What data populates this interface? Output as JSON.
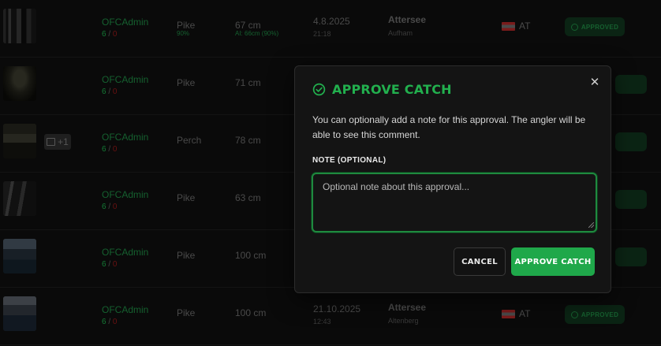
{
  "rows": [
    {
      "user": "OFCAdmin",
      "up": "6",
      "down": "0",
      "species": "Pike",
      "species_sub": "90%",
      "length": "67 cm",
      "length_sub": "AI: 66cm (90%)",
      "date": "4.8.2025",
      "time": "21:18",
      "lake": "Attersee",
      "place": "Aufham",
      "country": "AT",
      "status": "APPROVED"
    },
    {
      "user": "OFCAdmin",
      "up": "6",
      "down": "0",
      "species": "Pike",
      "length": "71 cm"
    },
    {
      "user": "OFCAdmin",
      "up": "6",
      "down": "0",
      "species": "Perch",
      "length": "78 cm",
      "extra": "+1"
    },
    {
      "user": "OFCAdmin",
      "up": "6",
      "down": "0",
      "species": "Pike",
      "length": "63 cm"
    },
    {
      "user": "OFCAdmin",
      "up": "6",
      "down": "0",
      "species": "Pike",
      "length": "100 cm"
    },
    {
      "user": "OFCAdmin",
      "up": "6",
      "down": "0",
      "species": "Pike",
      "length": "100 cm",
      "date": "21.10.2025",
      "time": "12:43",
      "lake": "Attersee",
      "place": "Altenberg",
      "country": "AT",
      "status": "APPROVED"
    }
  ],
  "modal": {
    "title": "APPROVE CATCH",
    "description": "You can optionally add a note for this approval. The angler will be able to see this comment.",
    "note_label": "NOTE (OPTIONAL)",
    "note_placeholder": "Optional note about this approval...",
    "note_value": "",
    "cancel_label": "CANCEL",
    "approve_label": "APPROVE CATCH",
    "close_icon": "close-icon",
    "title_icon": "check-circle-icon"
  },
  "colors": {
    "accent": "#22b04e",
    "approve_button": "#1fa84a"
  }
}
